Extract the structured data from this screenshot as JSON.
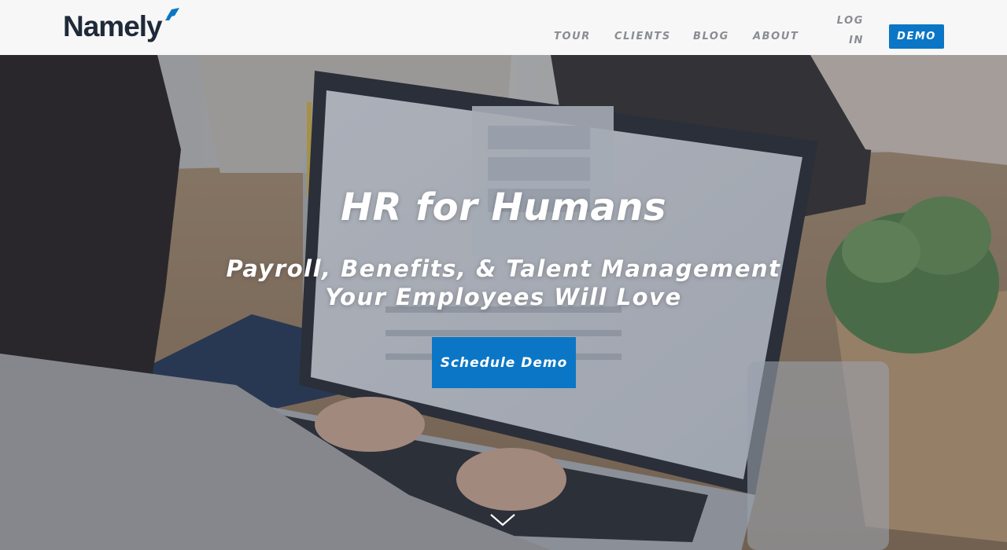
{
  "header": {
    "logo_text": "Namely",
    "nav": {
      "tour": "TOUR",
      "clients": "CLIENTS",
      "blog": "BLOG",
      "about": "ABOUT",
      "login_line1": "LOG",
      "login_line2": "IN",
      "demo": "DEMO"
    }
  },
  "hero": {
    "title": "HR for Humans",
    "subtitle": "Payroll, Benefits, & Talent Management Your Employees Will Love",
    "cta_label": "Schedule Demo"
  },
  "colors": {
    "accent": "#0b76c5",
    "logo_text": "#1e2a3a",
    "nav_text": "#8a8d92",
    "header_bg": "#f7f7f7"
  },
  "icons": {
    "logo_mark": "namely-flag-icon",
    "scroll": "chevron-down-icon"
  }
}
